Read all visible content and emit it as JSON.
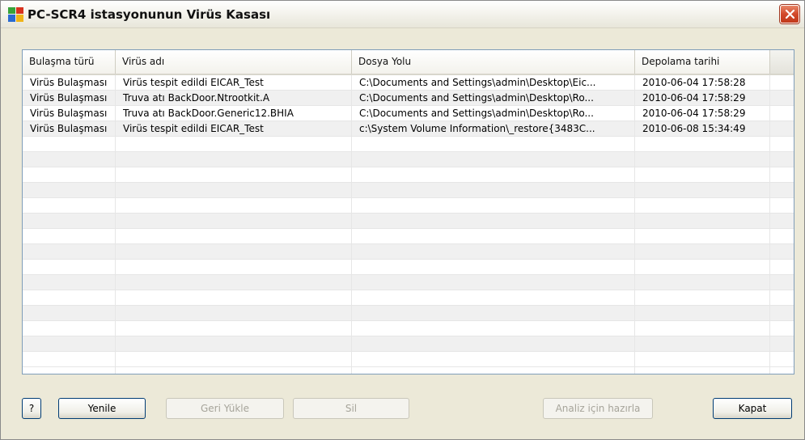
{
  "window": {
    "title": "PC-SCR4 istasyonunun Virüs Kasası"
  },
  "table": {
    "columns": [
      "Bulaşma türü",
      "Virüs adı",
      "Dosya Yolu",
      "Depolama tarihi"
    ],
    "rows": [
      [
        "Virüs Bulaşması",
        "Virüs tespit edildi EICAR_Test",
        "C:\\Documents and Settings\\admin\\Desktop\\Eic...",
        "2010-06-04 17:58:28"
      ],
      [
        "Virüs Bulaşması",
        "Truva atı BackDoor.Ntrootkit.A",
        "C:\\Documents and Settings\\admin\\Desktop\\Ro...",
        "2010-06-04 17:58:29"
      ],
      [
        "Virüs Bulaşması",
        "Truva atı BackDoor.Generic12.BHIA",
        "C:\\Documents and Settings\\admin\\Desktop\\Ro...",
        "2010-06-04 17:58:29"
      ],
      [
        "Virüs Bulaşması",
        "Virüs tespit edildi EICAR_Test",
        "c:\\System Volume Information\\_restore{3483C...",
        "2010-06-08 15:34:49"
      ]
    ]
  },
  "buttons": {
    "help": "?",
    "refresh": "Yenile",
    "restore": "Geri Yükle",
    "delete": "Sil",
    "prepare": "Analiz için hazırla",
    "close": "Kapat"
  }
}
